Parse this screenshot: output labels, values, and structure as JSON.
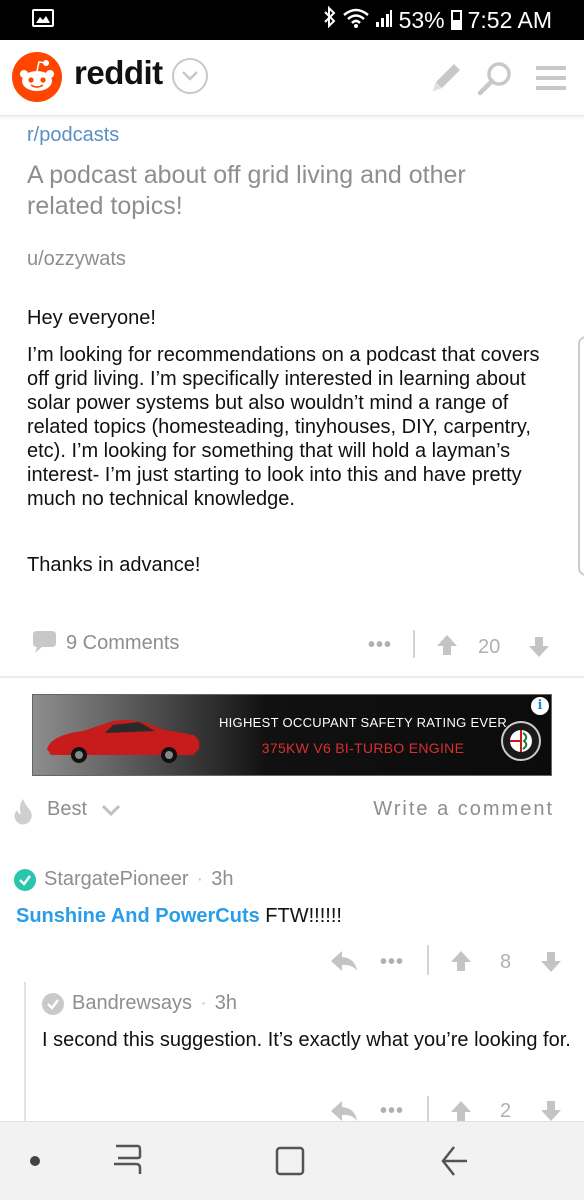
{
  "status_bar": {
    "battery_percent": "53%",
    "time": "7:52 AM",
    "icons": [
      "image-icon",
      "bluetooth-icon",
      "wifi-icon",
      "signal-icon",
      "battery-icon"
    ]
  },
  "header": {
    "app_name": "reddit",
    "icons": [
      "reddit-logo-icon",
      "chevron-down-icon",
      "pencil-icon",
      "search-icon",
      "menu-icon"
    ],
    "brand_color": "#ff4500"
  },
  "post": {
    "subreddit": "r/podcasts",
    "title": "A podcast about off grid living and other related topics!",
    "author": "u/ozzywats",
    "paragraphs": [
      "Hey everyone!",
      "I’m looking for recommendations on a podcast that covers off grid living. I’m specifically interested in learning about solar power systems but also wouldn’t mind a range of related topics (homesteading, tinyhouses, DIY, carpentry, etc). I’m looking for something that will hold a layman’s interest- I’m just starting to look into this and have pretty much no technical knowledge.",
      "Thanks in advance!"
    ],
    "comments_label": "9 Comments",
    "more": "•••",
    "score": "20"
  },
  "ad": {
    "line1": "HIGHEST OCCUPANT SAFETY RATING EVER",
    "line2": "375KW V6 BI-TURBO ENGINE",
    "info": "i"
  },
  "sort": {
    "label": "Best",
    "write_comment": "Write a comment"
  },
  "comments": [
    {
      "user": "StargatePioneer",
      "sep": "·",
      "age": "3h",
      "link_text": "Sunshine And PowerCuts",
      "text": " FTW!!!!!!",
      "more": "•••",
      "score": "8",
      "check_color": "#2bc4ad"
    },
    {
      "user": "Bandrewsays",
      "sep": "·",
      "age": "3h",
      "text": "I second this suggestion. It’s exactly what you’re looking for.",
      "more": "•••",
      "score": "2",
      "check_color": "#c9c9c9"
    }
  ],
  "colors": {
    "link_blue": "#2a9de8",
    "subreddit_blue": "#5a8fc6",
    "muted_gray": "#8e8e8e"
  }
}
